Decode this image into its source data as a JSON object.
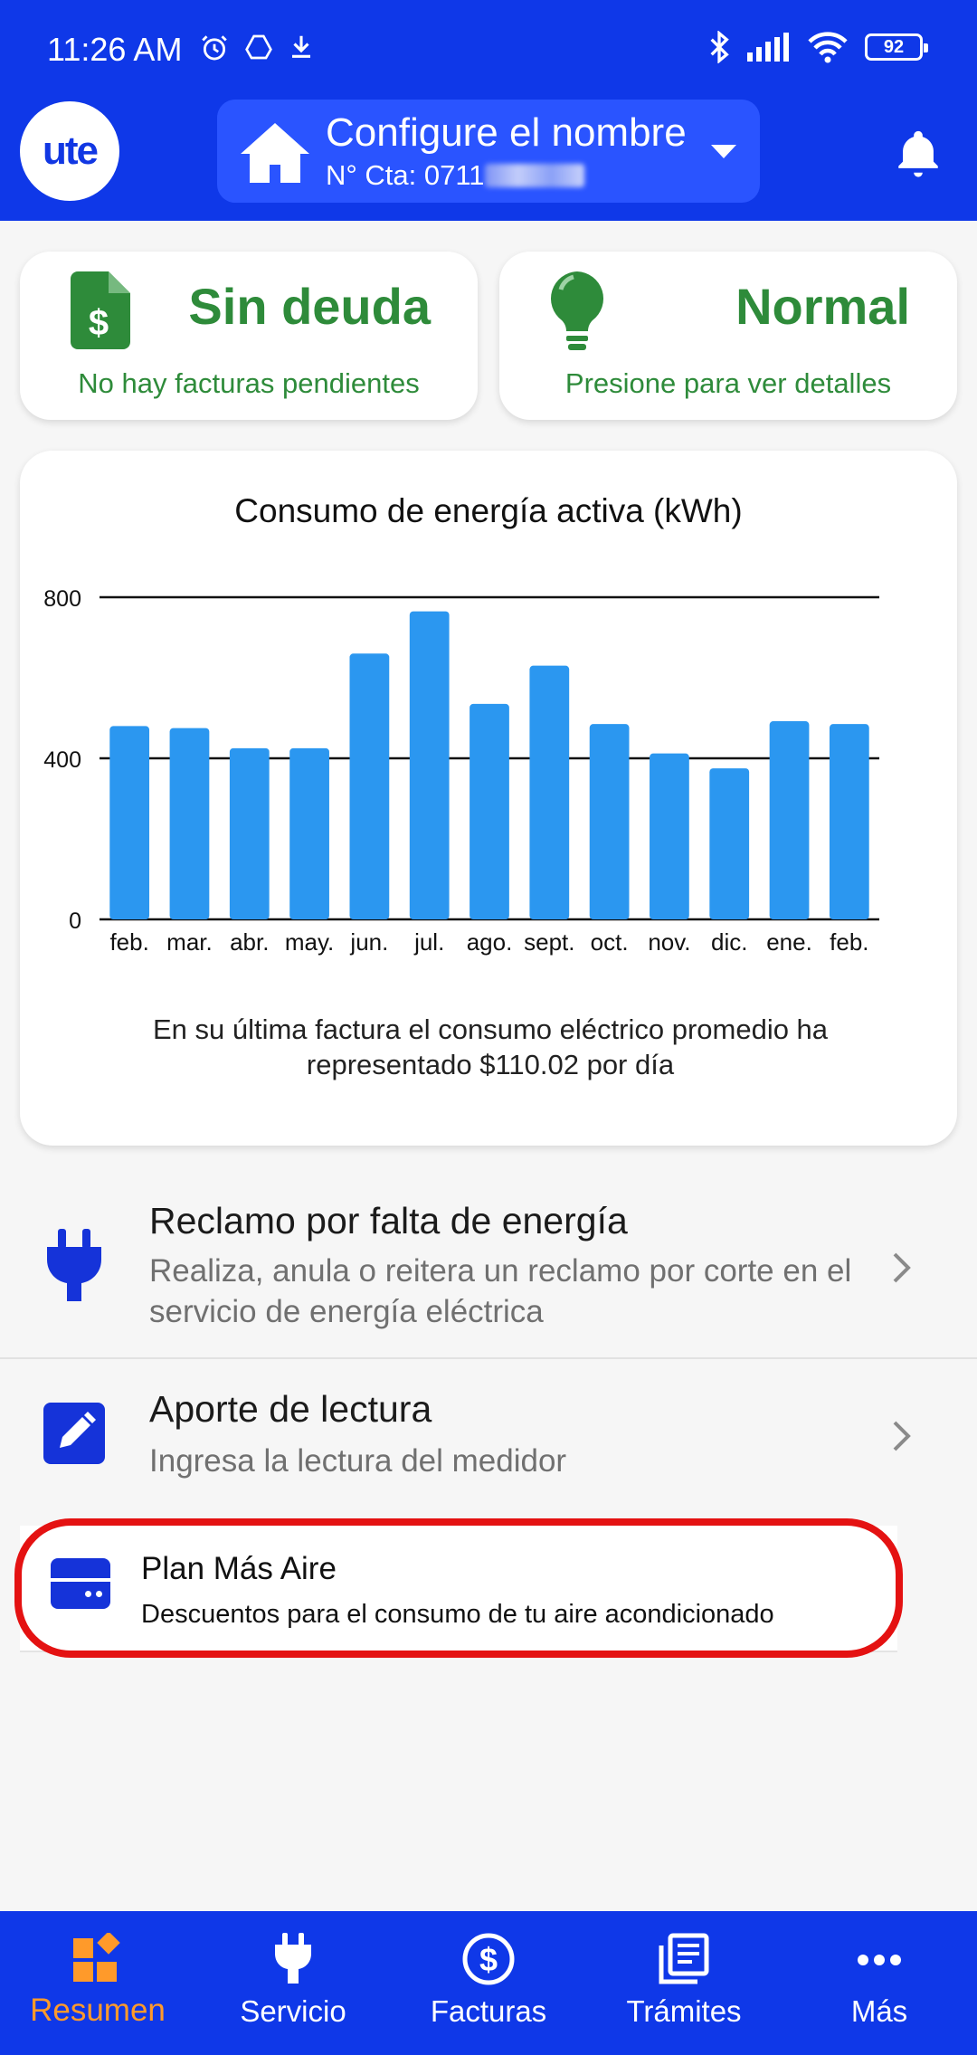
{
  "status_bar": {
    "time": "11:26 AM",
    "battery": "92",
    "icons": [
      "alarm-icon",
      "drive-icon",
      "download-icon",
      "bluetooth-icon",
      "signal-icon",
      "wifi-icon",
      "battery-icon"
    ]
  },
  "header": {
    "logo_text": "ute",
    "account_name": "Configure el nombre",
    "account_number_prefix": "N° Cta: 0711"
  },
  "cards": {
    "debt": {
      "title": "Sin deuda",
      "subtitle": "No hay facturas pendientes",
      "icon": "invoice-dollar-icon"
    },
    "consumption": {
      "title": "Normal",
      "subtitle": "Presione para ver detalles",
      "icon": "lightbulb-icon"
    }
  },
  "chart_data": {
    "type": "bar",
    "title": "Consumo de energía activa (kWh)",
    "categories": [
      "feb.",
      "mar.",
      "abr.",
      "may.",
      "jun.",
      "jul.",
      "ago.",
      "sept.",
      "oct.",
      "nov.",
      "dic.",
      "ene.",
      "feb."
    ],
    "values": [
      480,
      475,
      425,
      425,
      660,
      765,
      535,
      630,
      485,
      412,
      375,
      492,
      485
    ],
    "yticks": [
      0,
      400,
      800
    ],
    "ylim": [
      0,
      800
    ],
    "grid": true,
    "color": "#2b97f0"
  },
  "chart_note": "En su última factura el consumo eléctrico promedio ha representado $110.02 por día",
  "list": {
    "reclamo": {
      "title": "Reclamo por falta de energía",
      "description": "Realiza, anula o reitera un reclamo por corte en el servicio de energía eléctrica",
      "icon": "plug-icon"
    },
    "lectura": {
      "title": "Aporte de lectura",
      "description": "Ingresa la lectura del medidor",
      "icon": "edit-icon"
    },
    "plan": {
      "title": "Plan Más Aire",
      "description": "Descuentos para el consumo de tu aire acondicionado",
      "icon": "air-conditioner-icon"
    }
  },
  "nav": {
    "items": [
      {
        "label": "Resumen",
        "icon": "dashboard-icon",
        "active": true
      },
      {
        "label": "Servicio",
        "icon": "plug-icon"
      },
      {
        "label": "Facturas",
        "icon": "dollar-circle-icon"
      },
      {
        "label": "Trámites",
        "icon": "documents-icon"
      },
      {
        "label": "Más",
        "icon": "more-icon"
      }
    ]
  },
  "colors": {
    "brand_blue": "#0f38e8",
    "green": "#2e8b3a",
    "accent_orange": "#ff9a2a",
    "highlight_red": "#e41212"
  }
}
